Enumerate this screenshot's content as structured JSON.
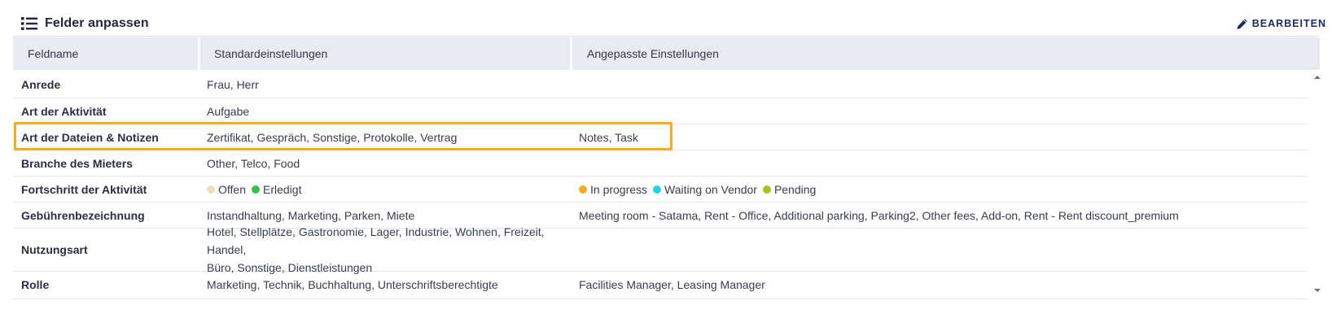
{
  "header": {
    "title": "Felder anpassen",
    "title_icon": "list-icon",
    "edit_label": "BEARBEITEN",
    "edit_icon": "pencil-icon"
  },
  "table": {
    "columns": [
      "Feldname",
      "Standardeinstellungen",
      "Angepasste Einstellungen"
    ],
    "rows": [
      {
        "name": "Anrede",
        "standard": "Frau, Herr",
        "custom": ""
      },
      {
        "name": "Art der Aktivität",
        "standard": "Aufgabe",
        "custom": ""
      },
      {
        "name": "Art der Dateien & Notizen",
        "standard": "Zertifikat, Gespräch, Sonstige, Protokolle, Vertrag",
        "custom": "Notes, Task",
        "highlighted": true
      },
      {
        "name": "Branche des Mieters",
        "standard": "Other, Telco, Food",
        "custom": ""
      },
      {
        "name": "Fortschritt der Aktivität",
        "standard_chips": [
          {
            "label": "Offen",
            "color": "#f5dcb8"
          },
          {
            "label": "Erledigt",
            "color": "#3dbb4a"
          }
        ],
        "custom_chips": [
          {
            "label": "In progress",
            "color": "#f6aa1c"
          },
          {
            "label": "Waiting on Vendor",
            "color": "#22d3e6"
          },
          {
            "label": "Pending",
            "color": "#a8c21c"
          }
        ]
      },
      {
        "name": "Gebührenbezeichnung",
        "standard": "Instandhaltung, Marketing, Parken, Miete",
        "custom": "Meeting room - Satama, Rent - Office, Additional parking, Parking2, Other fees, Add-on, Rent - Rent discount_premium"
      },
      {
        "name": "Nutzungsart",
        "standard_line1": "Hotel, Stellplätze, Gastronomie, Lager, Industrie, Wohnen, Freizeit, Handel,",
        "standard_line2": "Büro, Sonstige, Dienstleistungen",
        "custom": ""
      },
      {
        "name": "Rolle",
        "standard": "Marketing, Technik, Buchhaltung, Unterschriftsberechtigte",
        "custom": "Facilities Manager, Leasing Manager"
      }
    ]
  },
  "colors": {
    "highlight": "#f6aa1c",
    "header_bg": "#e9ebf2",
    "edit_accent": "#1e2b62"
  }
}
